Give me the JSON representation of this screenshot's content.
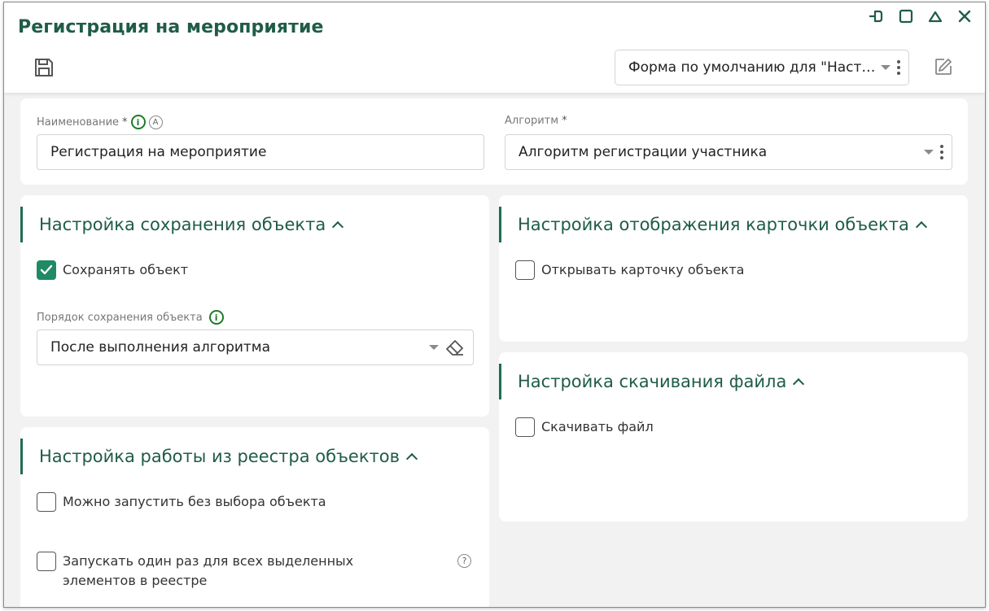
{
  "window": {
    "title": "Регистрация на мероприятие",
    "controls": [
      "pin-icon",
      "maximize-icon",
      "minimize-icon",
      "close-icon"
    ]
  },
  "toolbar": {
    "save_icon": "save-icon",
    "form_select_value": "Форма по умолчанию для \"Настр...",
    "edit_icon": "edit-icon"
  },
  "general": {
    "name_label": "Наименование",
    "name_required": "*",
    "name_value": "Регистрация на мероприятие",
    "algorithm_label": "Алгоритм",
    "algorithm_required": "*",
    "algorithm_value": "Алгоритм регистрации участника"
  },
  "save_section": {
    "title": "Настройка сохранения объекта",
    "save_object_label": "Сохранять объект",
    "save_object_checked": true,
    "order_label": "Порядок сохранения объекта",
    "order_value": "После выполнения алгоритма"
  },
  "display_section": {
    "title": "Настройка отображения карточки объекта",
    "open_card_label": "Открывать карточку объекта",
    "open_card_checked": false
  },
  "download_section": {
    "title": "Настройка скачивания файла",
    "download_label": "Скачивать файл",
    "download_checked": false
  },
  "registry_section": {
    "title": "Настройка работы из реестра объектов",
    "run_without_selection_label": "Можно запустить без выбора объекта",
    "run_without_selection_checked": false,
    "run_once_label": "Запускать один раз для всех выделенных элементов в реестре",
    "run_once_checked": false
  },
  "colors": {
    "accent": "#1f5c48",
    "checkbox_checked": "#1f8a64",
    "info_icon": "#1f7a28"
  }
}
